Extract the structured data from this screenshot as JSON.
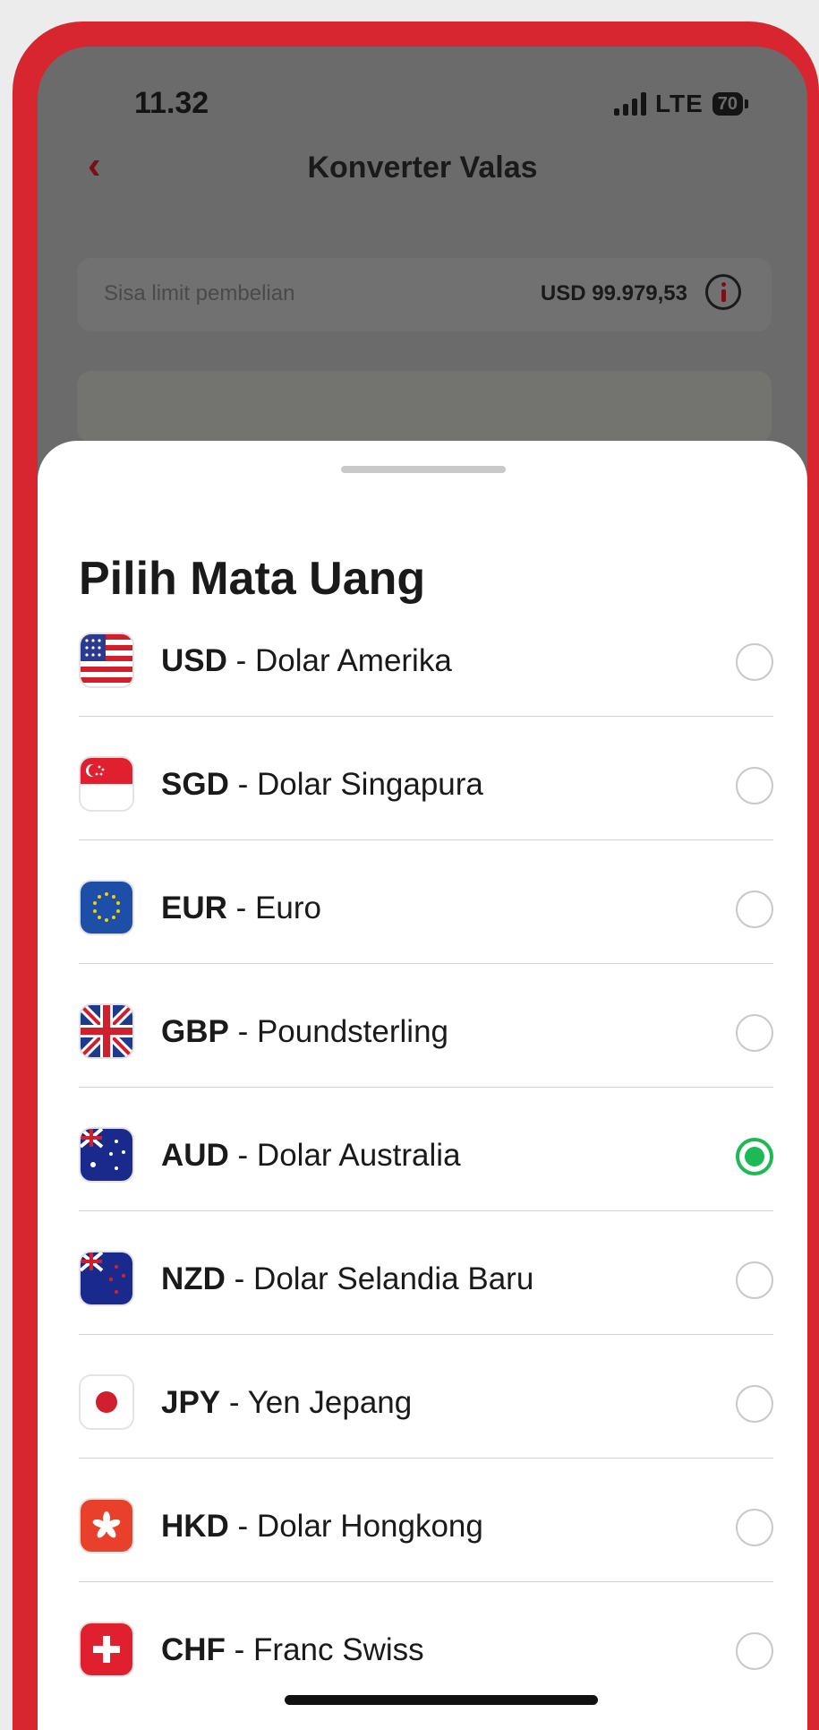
{
  "status_bar": {
    "time": "11.32",
    "network": "LTE",
    "battery": "70"
  },
  "header": {
    "back_icon": "chevron-left-icon",
    "title": "Konverter Valas"
  },
  "limit": {
    "label": "Sisa limit pembelian",
    "value": "USD 99.979,53",
    "info_icon": "info-icon"
  },
  "sheet": {
    "title": "Pilih Mata Uang",
    "currencies": [
      {
        "code": "USD",
        "name": " - Dolar Amerika",
        "flag_icon": "us-flag-icon",
        "selected": false
      },
      {
        "code": "SGD",
        "name": " - Dolar Singapura",
        "flag_icon": "sg-flag-icon",
        "selected": false
      },
      {
        "code": "EUR",
        "name": " - Euro",
        "flag_icon": "eu-flag-icon",
        "selected": false
      },
      {
        "code": "GBP",
        "name": " - Poundsterling",
        "flag_icon": "uk-flag-icon",
        "selected": false
      },
      {
        "code": "AUD",
        "name": " - Dolar Australia",
        "flag_icon": "au-flag-icon",
        "selected": true
      },
      {
        "code": "NZD",
        "name": " - Dolar Selandia Baru",
        "flag_icon": "nz-flag-icon",
        "selected": false
      },
      {
        "code": "JPY",
        "name": " - Yen Jepang",
        "flag_icon": "jp-flag-icon",
        "selected": false
      },
      {
        "code": "HKD",
        "name": " - Dolar Hongkong",
        "flag_icon": "hk-flag-icon",
        "selected": false
      },
      {
        "code": "CHF",
        "name": " - Franc Swiss",
        "flag_icon": "ch-flag-icon",
        "selected": false
      }
    ]
  },
  "colors": {
    "frame": "#d7262f",
    "accent": "#7a1015",
    "selected": "#1db954"
  }
}
